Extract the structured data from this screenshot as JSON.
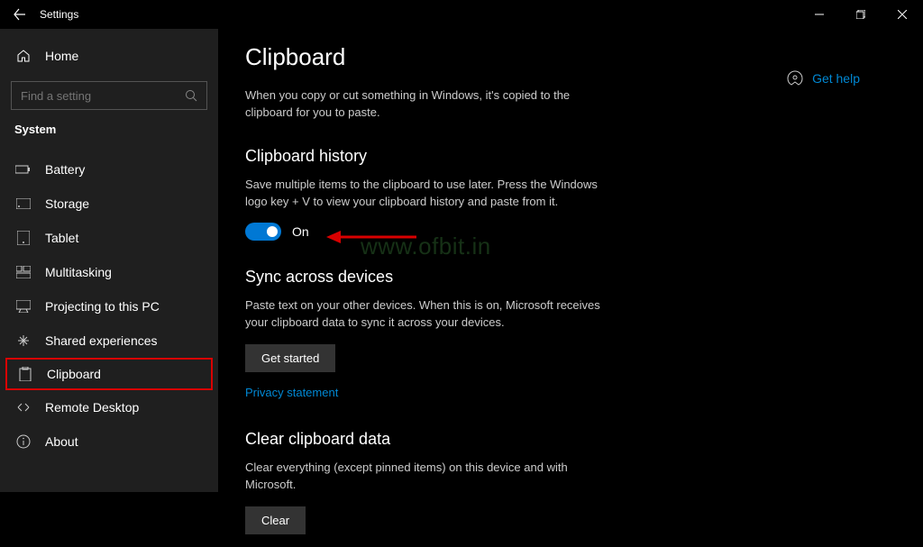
{
  "titlebar": {
    "title": "Settings"
  },
  "sidebar": {
    "home_label": "Home",
    "search_placeholder": "Find a setting",
    "section_label": "System",
    "items": [
      {
        "label": "Battery",
        "icon": "battery-icon"
      },
      {
        "label": "Storage",
        "icon": "storage-icon"
      },
      {
        "label": "Tablet",
        "icon": "tablet-icon"
      },
      {
        "label": "Multitasking",
        "icon": "multitasking-icon"
      },
      {
        "label": "Projecting to this PC",
        "icon": "projecting-icon"
      },
      {
        "label": "Shared experiences",
        "icon": "shared-icon"
      },
      {
        "label": "Clipboard",
        "icon": "clipboard-icon"
      },
      {
        "label": "Remote Desktop",
        "icon": "remote-icon"
      },
      {
        "label": "About",
        "icon": "about-icon"
      }
    ]
  },
  "content": {
    "page_title": "Clipboard",
    "intro": "When you copy or cut something in Windows, it's copied to the clipboard for you to paste.",
    "history": {
      "heading": "Clipboard history",
      "desc": "Save multiple items to the clipboard to use later. Press the Windows logo key + V to view your clipboard history and paste from it.",
      "toggle_state": "On",
      "toggle_on": true
    },
    "sync": {
      "heading": "Sync across devices",
      "desc": "Paste text on your other devices. When this is on, Microsoft receives your clipboard data to sync it across your devices.",
      "button": "Get started",
      "privacy_link": "Privacy statement"
    },
    "clear": {
      "heading": "Clear clipboard data",
      "desc": "Clear everything (except pinned items) on this device and with Microsoft.",
      "button": "Clear"
    }
  },
  "help": {
    "label": "Get help"
  },
  "watermark": "www.ofbit.in",
  "annotation": {
    "selected_item": "Clipboard",
    "arrow_color": "#d80000"
  }
}
